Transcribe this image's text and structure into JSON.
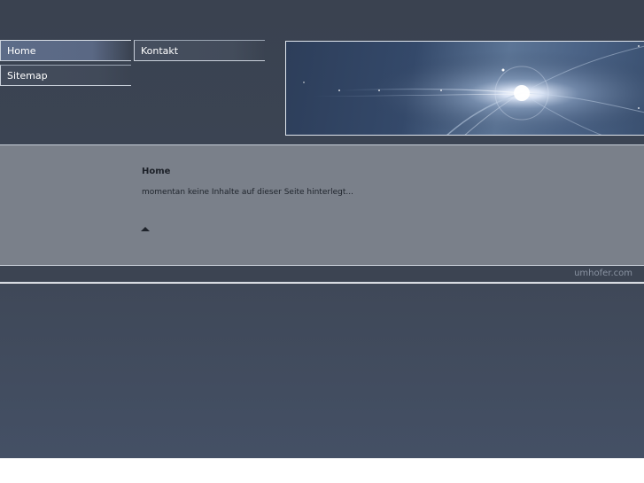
{
  "nav": {
    "items": [
      {
        "label": "Home",
        "active": true
      },
      {
        "label": "Sitemap",
        "active": false
      },
      {
        "label": "Kontakt",
        "active": false
      }
    ]
  },
  "main": {
    "title": "Home",
    "text": "momentan keine Inhalte auf dieser Seite hinterlegt..."
  },
  "footer": {
    "credit": "umhofer.com"
  },
  "colors": {
    "header_bg": "#3a4250",
    "content_bg": "#7a808a",
    "active_nav": "#5d6c88",
    "lower_bg": "#445065"
  }
}
